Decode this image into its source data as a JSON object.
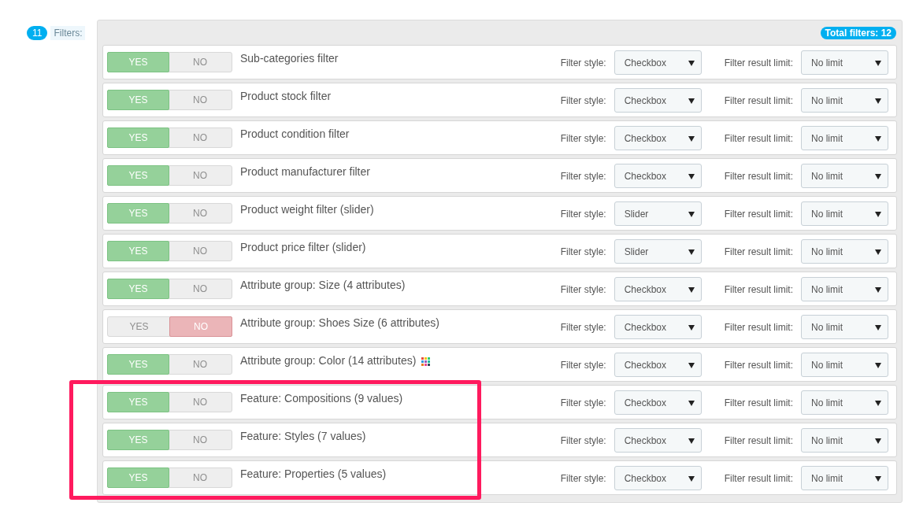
{
  "header": {
    "count": "11",
    "label": "Filters:"
  },
  "total": "Total filters: 12",
  "rows": [
    {
      "title": "Sub-categories filter",
      "yes": "YES",
      "no": "NO",
      "on": true,
      "style_label": "Filter style:",
      "style": "Checkbox",
      "limit_label": "Filter result limit:",
      "limit": "No limit",
      "color_icon": false,
      "highlighted": false
    },
    {
      "title": "Product stock filter",
      "yes": "YES",
      "no": "NO",
      "on": true,
      "style_label": "Filter style:",
      "style": "Checkbox",
      "limit_label": "Filter result limit:",
      "limit": "No limit",
      "color_icon": false,
      "highlighted": false
    },
    {
      "title": "Product condition filter",
      "yes": "YES",
      "no": "NO",
      "on": true,
      "style_label": "Filter style:",
      "style": "Checkbox",
      "limit_label": "Filter result limit:",
      "limit": "No limit",
      "color_icon": false,
      "highlighted": false
    },
    {
      "title": "Product manufacturer filter",
      "yes": "YES",
      "no": "NO",
      "on": true,
      "style_label": "Filter style:",
      "style": "Checkbox",
      "limit_label": "Filter result limit:",
      "limit": "No limit",
      "color_icon": false,
      "highlighted": false
    },
    {
      "title": "Product weight filter (slider)",
      "yes": "YES",
      "no": "NO",
      "on": true,
      "style_label": "Filter style:",
      "style": "Slider",
      "limit_label": "Filter result limit:",
      "limit": "No limit",
      "color_icon": false,
      "highlighted": false
    },
    {
      "title": "Product price filter (slider)",
      "yes": "YES",
      "no": "NO",
      "on": true,
      "style_label": "Filter style:",
      "style": "Slider",
      "limit_label": "Filter result limit:",
      "limit": "No limit",
      "color_icon": false,
      "highlighted": false
    },
    {
      "title": "Attribute group: Size (4 attributes)",
      "yes": "YES",
      "no": "NO",
      "on": true,
      "style_label": "Filter style:",
      "style": "Checkbox",
      "limit_label": "Filter result limit:",
      "limit": "No limit",
      "color_icon": false,
      "highlighted": false
    },
    {
      "title": "Attribute group: Shoes Size (6 attributes)",
      "yes": "YES",
      "no": "NO",
      "on": false,
      "style_label": "Filter style:",
      "style": "Checkbox",
      "limit_label": "Filter result limit:",
      "limit": "No limit",
      "color_icon": false,
      "highlighted": false
    },
    {
      "title": "Attribute group: Color (14 attributes)",
      "yes": "YES",
      "no": "NO",
      "on": true,
      "style_label": "Filter style:",
      "style": "Checkbox",
      "limit_label": "Filter result limit:",
      "limit": "No limit",
      "color_icon": true,
      "highlighted": false
    },
    {
      "title": "Feature: Compositions (9 values)",
      "yes": "YES",
      "no": "NO",
      "on": true,
      "style_label": "Filter style:",
      "style": "Checkbox",
      "limit_label": "Filter result limit:",
      "limit": "No limit",
      "color_icon": false,
      "highlighted": true
    },
    {
      "title": "Feature: Styles (7 values)",
      "yes": "YES",
      "no": "NO",
      "on": true,
      "style_label": "Filter style:",
      "style": "Checkbox",
      "limit_label": "Filter result limit:",
      "limit": "No limit",
      "color_icon": false,
      "highlighted": true
    },
    {
      "title": "Feature: Properties (5 values)",
      "yes": "YES",
      "no": "NO",
      "on": true,
      "style_label": "Filter style:",
      "style": "Checkbox",
      "limit_label": "Filter result limit:",
      "limit": "No limit",
      "color_icon": false,
      "highlighted": true
    }
  ]
}
